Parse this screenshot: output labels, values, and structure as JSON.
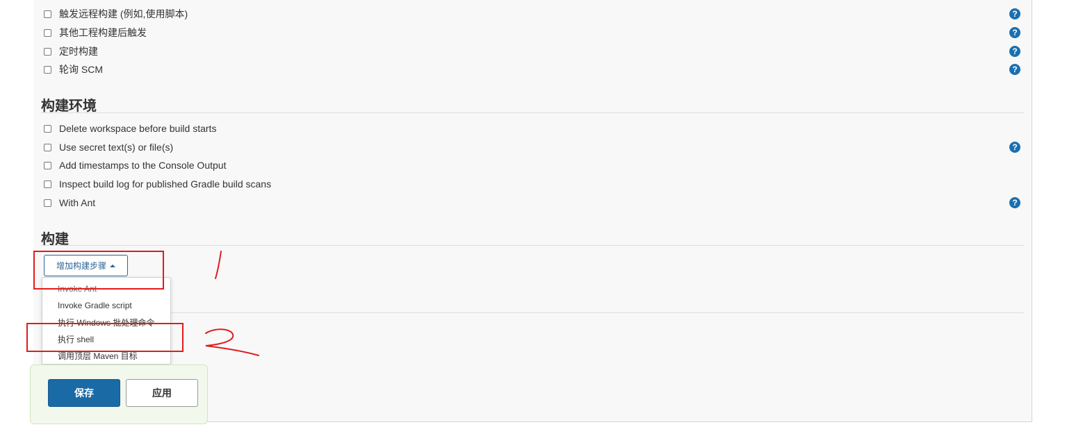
{
  "triggers": {
    "items": [
      {
        "label": "触发远程构建 (例如,使用脚本)",
        "has_help": true
      },
      {
        "label": "其他工程构建后触发",
        "has_help": true
      },
      {
        "label": "定时构建",
        "has_help": true
      },
      {
        "label": "轮询 SCM",
        "has_help": true
      }
    ]
  },
  "build_env": {
    "title": "构建环境",
    "items": [
      {
        "label": "Delete workspace before build starts",
        "has_help": false
      },
      {
        "label": "Use secret text(s) or file(s)",
        "has_help": true
      },
      {
        "label": "Add timestamps to the Console Output",
        "has_help": false
      },
      {
        "label": "Inspect build log for published Gradle build scans",
        "has_help": false
      },
      {
        "label": "With Ant",
        "has_help": true
      }
    ]
  },
  "build": {
    "title": "构建",
    "add_step_label": "增加构建步骤",
    "dropdown": [
      "Invoke Ant",
      "Invoke Gradle script",
      "执行 Windows 批处理命令",
      "执行 shell",
      "调用顶层 Maven 目标"
    ]
  },
  "footer": {
    "save_label": "保存",
    "apply_label": "应用"
  },
  "help_glyph": "?",
  "colors": {
    "accent": "#1a6aa6",
    "help": "#1a6fb0",
    "annotation": "#e21b1b"
  }
}
